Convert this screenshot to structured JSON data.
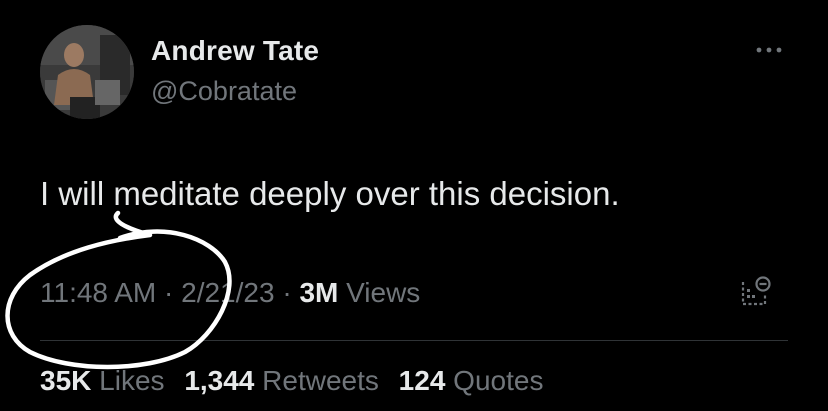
{
  "author": {
    "display_name": "Andrew Tate",
    "handle": "@Cobratate"
  },
  "tweet": {
    "text": "I will meditate deeply over this decision."
  },
  "meta": {
    "time": "11:48 AM",
    "sep1": " · ",
    "date": "2/21/23",
    "sep2": " · ",
    "views_count": "3M",
    "views_label": " Views"
  },
  "stats": {
    "likes_count": "35K",
    "likes_label": "Likes",
    "retweets_count": "1,344",
    "retweets_label": "Retweets",
    "quotes_count": "124",
    "quotes_label": "Quotes"
  },
  "icons": {
    "more": "more-options-icon",
    "analytics": "analytics-icon"
  },
  "colors": {
    "background": "#000000",
    "primary_text": "#e7e9ea",
    "secondary_text": "#71767b",
    "divider": "#2f3336",
    "annotation": "#ffffff"
  }
}
